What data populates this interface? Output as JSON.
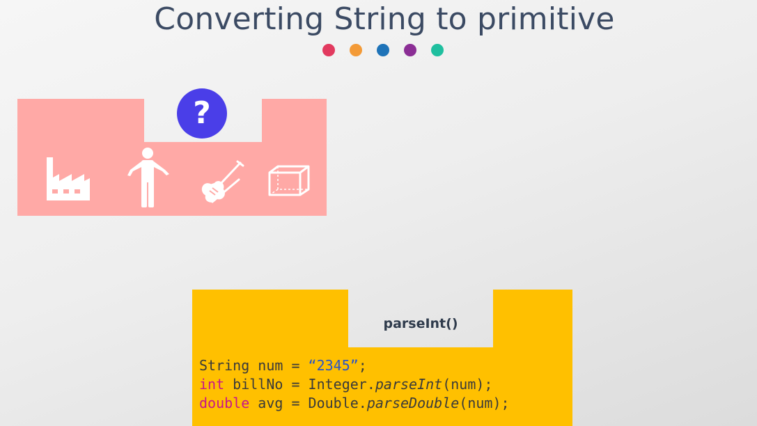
{
  "slide": {
    "title": "Converting String to primitive",
    "dot_colors": [
      "#e23a5f",
      "#f39a37",
      "#1e73b8",
      "#8b2e95",
      "#1fbf9f"
    ]
  },
  "pink_panel": {
    "color": "#ffa9a6",
    "badge_text": "?",
    "badge_color": "#4a3ee8",
    "icons": [
      "factory-icon",
      "person-icon",
      "violin-icon",
      "box-icon"
    ]
  },
  "code_panel": {
    "color": "#ffc000",
    "method_label": "parseInt()",
    "lines": [
      [
        {
          "t": "String num = "
        },
        {
          "t": "“2345”",
          "c": "str"
        },
        {
          "t": ";"
        }
      ],
      [
        {
          "t": "int",
          "c": "kw"
        },
        {
          "t": " billNo = Integer."
        },
        {
          "t": "parseInt",
          "c": "it"
        },
        {
          "t": "(num);"
        }
      ],
      [
        {
          "t": "double",
          "c": "kw"
        },
        {
          "t": " avg = Double."
        },
        {
          "t": "parseDouble",
          "c": "it"
        },
        {
          "t": "(num);"
        }
      ]
    ]
  }
}
